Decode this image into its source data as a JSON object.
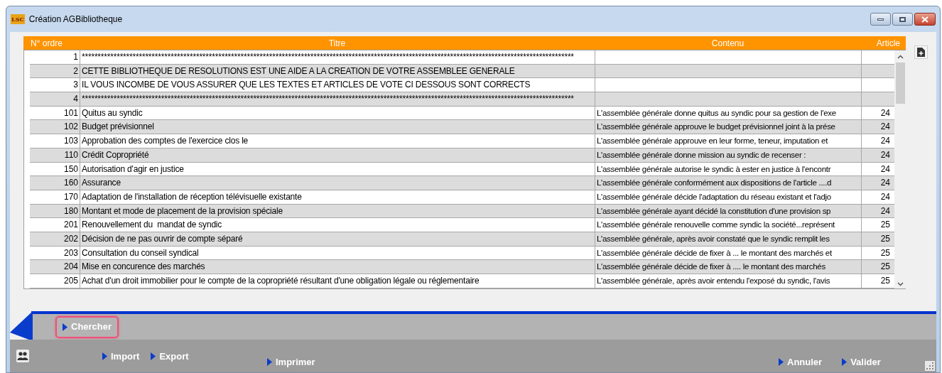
{
  "window": {
    "title": "Création AGBibliotheque",
    "app_badge": "LSC"
  },
  "table": {
    "columns": [
      "N° ordre",
      "Titre",
      "Contenu",
      "Article"
    ],
    "rows": [
      {
        "ordre": "1",
        "titre": "***********************************************************************************************************************************************************",
        "contenu": "",
        "article": ""
      },
      {
        "ordre": "2",
        "titre": "CETTE BIBLIOTHEQUE DE RESOLUTIONS EST UNE AIDE A LA CREATION DE VOTRE ASSEMBLEE GENERALE",
        "contenu": "",
        "article": ""
      },
      {
        "ordre": "3",
        "titre": "IL VOUS INCOMBE DE VOUS ASSURER QUE LES TEXTES ET ARTICLES DE VOTE CI DESSOUS SONT CORRECTS",
        "contenu": "",
        "article": ""
      },
      {
        "ordre": "4",
        "titre": "***********************************************************************************************************************************************************",
        "contenu": "",
        "article": ""
      },
      {
        "ordre": "101",
        "titre": "Quitus au syndic",
        "contenu": "L'assemblée générale donne quitus au syndic pour sa gestion de l'exe",
        "article": "24"
      },
      {
        "ordre": "102",
        "titre": "Budget prévisionnel",
        "contenu": "L'assemblée générale approuve le budget prévisionnel joint à la prése",
        "article": "24"
      },
      {
        "ordre": "103",
        "titre": "Approbation des comptes de l'exercice clos le",
        "contenu": "L'assemblée générale approuve en leur forme, teneur, imputation et",
        "article": "24"
      },
      {
        "ordre": "110",
        "titre": "Crédit Copropriété",
        "contenu": "L'assemblée générale donne mission au syndic de recenser :",
        "article": "24"
      },
      {
        "ordre": "150",
        "titre": "Autorisation d'agir en justice",
        "contenu": "L'assemblée générale autorise le syndic à ester en justice à l'encontr",
        "article": "24"
      },
      {
        "ordre": "160",
        "titre": "Assurance",
        "contenu": "L'assemblée générale conformément aux dispositions de l'article ....d",
        "article": "24"
      },
      {
        "ordre": "170",
        "titre": "Adaptation de l'installation de réception télévisuelle existante",
        "contenu": "L'assemblée générale décide l'adaptation du réseau existant et l'adjo",
        "article": "24"
      },
      {
        "ordre": "180",
        "titre": "Montant et mode de placement de la provision spéciale",
        "contenu": "L'assemblée générale ayant décidé la constitution d'une provision sp",
        "article": "24"
      },
      {
        "ordre": "201",
        "titre": "Renouvellement du  mandat de syndic",
        "contenu": "L'assemblée générale renouvelle comme syndic la société...représent",
        "article": "25"
      },
      {
        "ordre": "202",
        "titre": "Décision de ne pas ouvrir de compte séparé",
        "contenu": "L'assemblée générale, après avoir constaté que le syndic remplit les",
        "article": "25"
      },
      {
        "ordre": "203",
        "titre": "Consultation du conseil syndical",
        "contenu": "L'assemblée générale décide de fixer à ... le montant des marchés et",
        "article": "25"
      },
      {
        "ordre": "204",
        "titre": "Mise en concurence des marchés",
        "contenu": "L'assemblée générale décide de fixer à .... le montant des marchés",
        "article": "25"
      },
      {
        "ordre": "205",
        "titre": "Achat d'un droit immobilier pour le compte de la copropriété résultant d'une obligation légale ou réglementaire",
        "contenu": "L'assemblée générale, après avoir entendu l'exposé du syndic, l'avis",
        "article": "25"
      }
    ]
  },
  "search_button": {
    "label": "Chercher",
    "focused": true
  },
  "footer_buttons": [
    {
      "label": "Import",
      "kind": "left"
    },
    {
      "label": "Export",
      "kind": "left"
    },
    {
      "label": "Imprimer",
      "kind": "center"
    },
    {
      "label": "Annuler",
      "kind": "right"
    },
    {
      "label": "Valider",
      "kind": "right"
    }
  ]
}
